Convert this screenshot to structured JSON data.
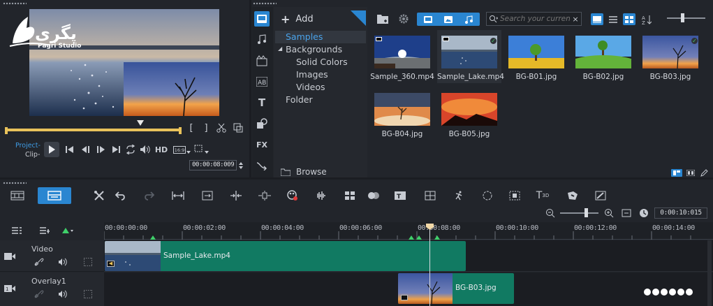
{
  "watermark": {
    "text": "پگری",
    "subtitle": "Pagri Studio"
  },
  "player": {
    "mode_project": "Project-",
    "mode_clip": "Clip-",
    "hd_label": "HD",
    "aspect_label": "16:9",
    "timecode": "00:00:08:009",
    "bracket_in": "[",
    "bracket_out": "]"
  },
  "library_nav": {
    "add_label": "Add",
    "tree": [
      {
        "label": "Samples",
        "selected": true
      },
      {
        "label": "Backgrounds",
        "expanded": true
      },
      {
        "label": "Solid Colors"
      },
      {
        "label": "Images"
      },
      {
        "label": "Videos"
      },
      {
        "label": "Folder"
      }
    ],
    "browse_label": "Browse",
    "side_icons": [
      "media-icon",
      "audio-icon",
      "instant-project-icon",
      "transition-icon",
      "title-icon",
      "graphic-icon",
      "fx-icon",
      "path-icon"
    ],
    "fx_label": "FX",
    "title_label": "T"
  },
  "library": {
    "search_placeholder": "Search your current v",
    "items": [
      {
        "label": "Sample_360.mp4",
        "kind": "video",
        "checked": false
      },
      {
        "label": "Sample_Lake.mp4",
        "kind": "video",
        "checked": true
      },
      {
        "label": "BG-B01.jpg",
        "kind": "image",
        "checked": false
      },
      {
        "label": "BG-B02.jpg",
        "kind": "image",
        "checked": false
      },
      {
        "label": "BG-B03.jpg",
        "kind": "image",
        "checked": true
      },
      {
        "label": "BG-B04.jpg",
        "kind": "image",
        "checked": false
      },
      {
        "label": "BG-B05.jpg",
        "kind": "image",
        "checked": false
      }
    ]
  },
  "timeline": {
    "zoom_timecode": "0:00:10:015",
    "ruler": [
      "00:00:00:00",
      "00:00:02:00",
      "00:00:04:00",
      "00:00:06:00",
      "00:00:08:00",
      "00:00:10:00",
      "00:00:12:00",
      "00:00:14:00"
    ],
    "tracks": [
      {
        "name": "Video",
        "clips": [
          {
            "label": "Sample_Lake.mp4"
          }
        ]
      },
      {
        "name": "Overlay1",
        "clips": [
          {
            "label": "BG-B03.jpg"
          }
        ]
      }
    ]
  },
  "colors": {
    "accent": "#2a86d1",
    "clip_green": "#117a62",
    "panel": "#22252b",
    "bg": "#1b1d22"
  }
}
